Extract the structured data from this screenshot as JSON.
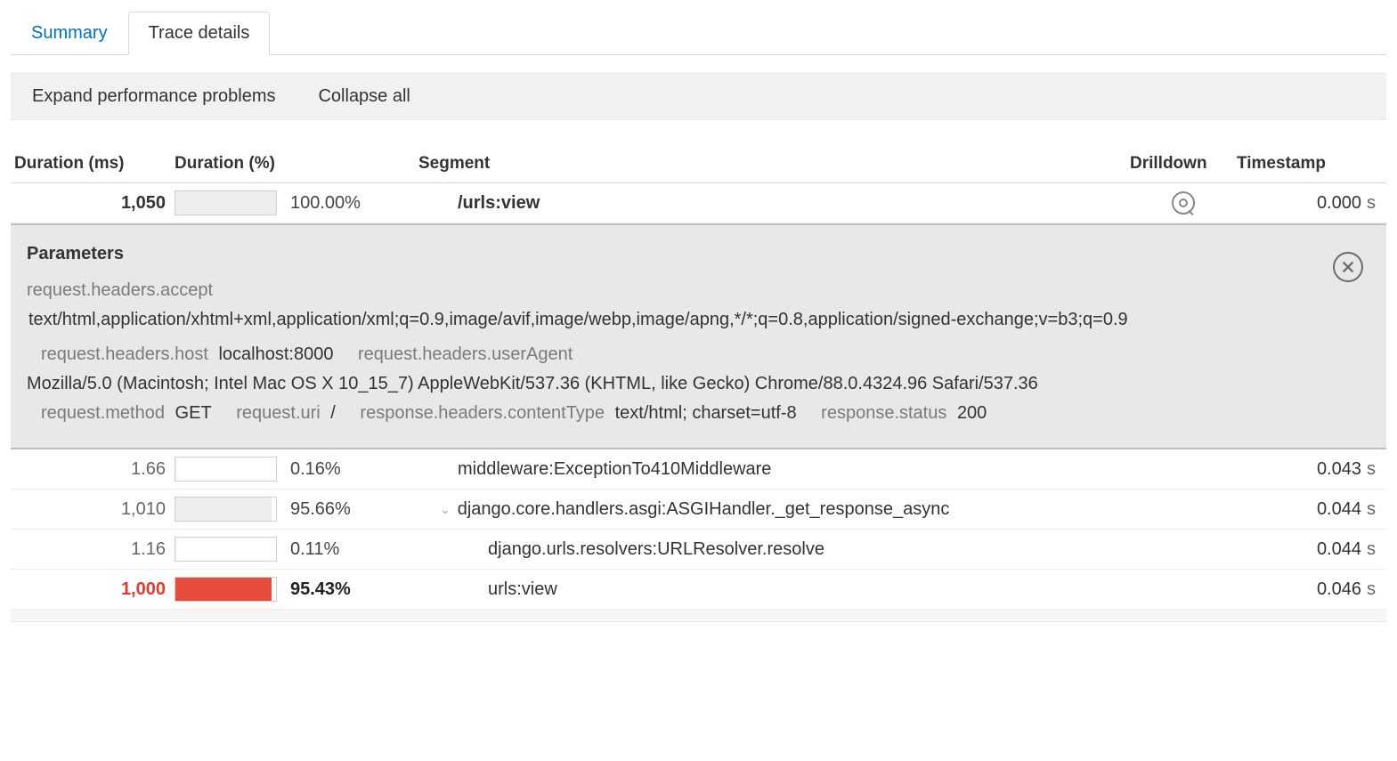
{
  "tabs": {
    "summary": "Summary",
    "trace_details": "Trace details"
  },
  "toolbar": {
    "expand": "Expand performance problems",
    "collapse": "Collapse all"
  },
  "headers": {
    "dur_ms": "Duration (ms)",
    "dur_pct": "Duration (%)",
    "segment": "Segment",
    "drilldown": "Drilldown",
    "timestamp": "Timestamp"
  },
  "unit": "s",
  "rows": [
    {
      "ms": "1,050",
      "pct": "100.00%",
      "segment": "/urls:view",
      "ts": "0.000",
      "bar_w": "100%",
      "bar_color": "grey",
      "ms_style": "bold",
      "pct_style": "",
      "seg_style": "bold",
      "indent": "indent1",
      "drill": true
    },
    {
      "ms": "1.66",
      "pct": "0.16%",
      "segment": "middleware:ExceptionTo410Middleware",
      "ts": "0.043",
      "bar_w": "0.2%",
      "bar_color": "grey",
      "ms_style": "",
      "pct_style": "",
      "seg_style": "",
      "indent": "indent1",
      "drill": false
    },
    {
      "ms": "1,010",
      "pct": "95.66%",
      "segment": "django.core.handlers.asgi:ASGIHandler._get_response_async",
      "ts": "0.044",
      "bar_w": "95.7%",
      "bar_color": "grey",
      "ms_style": "",
      "pct_style": "",
      "seg_style": "",
      "indent": "indent2",
      "drill": false,
      "chev": true
    },
    {
      "ms": "1.16",
      "pct": "0.11%",
      "segment": "django.urls.resolvers:URLResolver.resolve",
      "ts": "0.044",
      "bar_w": "0.1%",
      "bar_color": "grey",
      "ms_style": "",
      "pct_style": "",
      "seg_style": "",
      "indent": "indent3",
      "drill": false
    },
    {
      "ms": "1,000",
      "pct": "95.43%",
      "segment": "urls:view",
      "ts": "0.046",
      "bar_w": "95.4%",
      "bar_color": "red",
      "ms_style": "red",
      "pct_style": "bold",
      "seg_style": "",
      "indent": "indent3",
      "drill": false
    }
  ],
  "params": {
    "title": "Parameters",
    "accept_key": "request.headers.accept",
    "accept_val": "text/html,application/xhtml+xml,application/xml;q=0.9,image/avif,image/webp,image/apng,*/*;q=0.8,application/signed-exchange;v=b3;q=0.9",
    "host_key": "request.headers.host",
    "host_val": "localhost:8000",
    "ua_key": "request.headers.userAgent",
    "ua_val": "Mozilla/5.0 (Macintosh; Intel Mac OS X 10_15_7) AppleWebKit/537.36 (KHTML, like Gecko) Chrome/88.0.4324.96 Safari/537.36",
    "method_key": "request.method",
    "method_val": "GET",
    "uri_key": "request.uri",
    "uri_val": "/",
    "ct_key": "response.headers.contentType",
    "ct_val": "text/html; charset=utf-8",
    "status_key": "response.status",
    "status_val": "200"
  }
}
